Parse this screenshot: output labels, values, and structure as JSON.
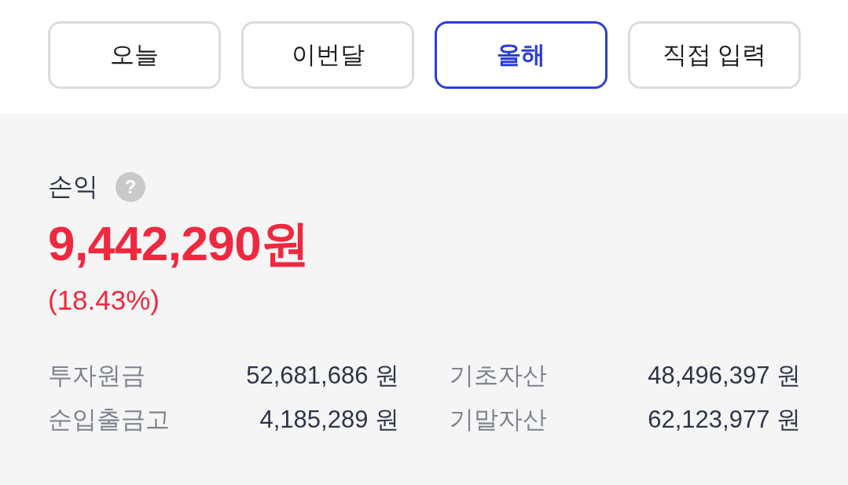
{
  "periods": [
    {
      "label": "오늘",
      "selected": false
    },
    {
      "label": "이번달",
      "selected": false
    },
    {
      "label": "올해",
      "selected": true
    },
    {
      "label": "직접 입력",
      "selected": false
    }
  ],
  "summary": {
    "title": "손익",
    "help_icon": "?",
    "amount": "9,442,290원",
    "rate": "(18.43%)"
  },
  "details": [
    {
      "label": "투자원금",
      "value": "52,681,686 원"
    },
    {
      "label": "기초자산",
      "value": "48,496,397 원"
    },
    {
      "label": "순입출금고",
      "value": "4,185,289 원"
    },
    {
      "label": "기말자산",
      "value": "62,123,977 원"
    }
  ]
}
